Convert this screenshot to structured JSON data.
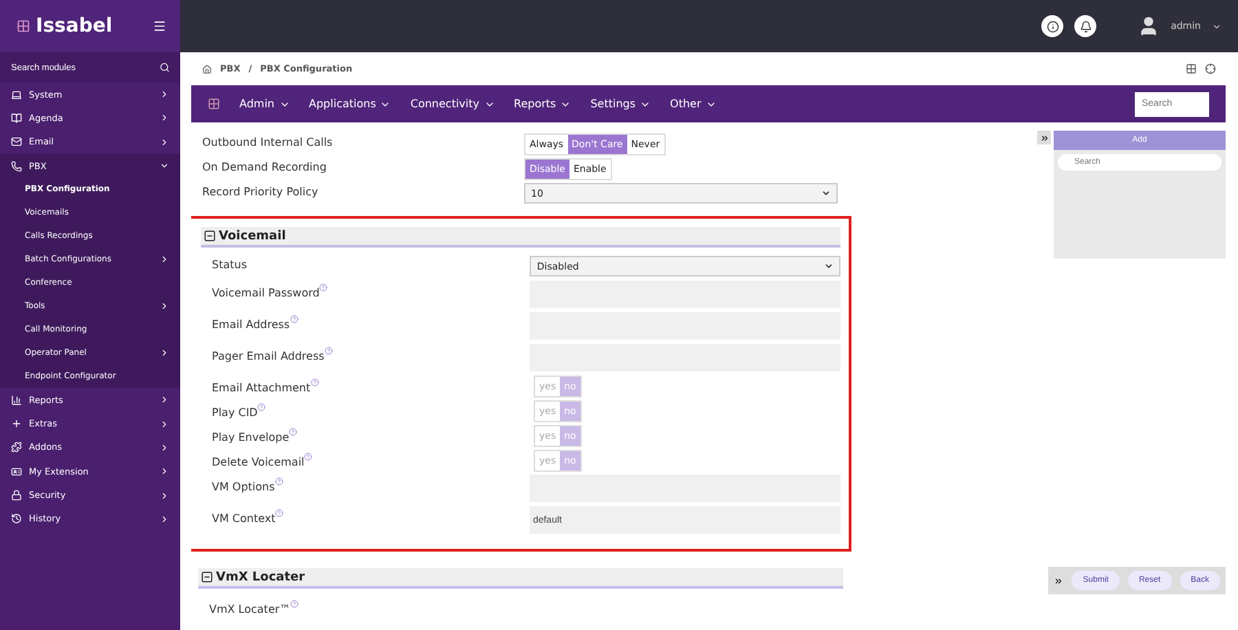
{
  "sidebar": {
    "logo": "Issabel",
    "search": {
      "placeholder": "Search modules"
    },
    "items": [
      {
        "label": "System",
        "selected": false,
        "expanded": false
      },
      {
        "label": "Agenda",
        "selected": false,
        "expanded": false
      },
      {
        "label": "Email",
        "selected": false,
        "expanded": false
      },
      {
        "label": "PBX",
        "selected": true,
        "expanded": true,
        "children": [
          {
            "label": "PBX Configuration",
            "kind": "link",
            "selected": true
          },
          {
            "label": "Voicemails",
            "kind": "link",
            "selected": false
          },
          {
            "label": "Calls Recordings",
            "kind": "link",
            "selected": false
          },
          {
            "label": "Batch Configurations",
            "kind": "group",
            "selected": false,
            "expanded": false
          },
          {
            "label": "Conference",
            "kind": "link",
            "selected": false
          },
          {
            "label": "Tools",
            "kind": "group",
            "selected": false,
            "expanded": false
          },
          {
            "label": "Call Monitoring",
            "kind": "link",
            "selected": false
          },
          {
            "label": "Operator Panel",
            "kind": "group",
            "selected": false,
            "expanded": false
          },
          {
            "label": "Endpoint Configurator",
            "kind": "link",
            "selected": false
          }
        ]
      },
      {
        "label": "Reports",
        "selected": false,
        "expanded": false
      },
      {
        "label": "Extras",
        "selected": false,
        "expanded": false
      },
      {
        "label": "Addons",
        "selected": false,
        "expanded": false
      },
      {
        "label": "My Extension",
        "selected": false,
        "expanded": false
      },
      {
        "label": "Security",
        "selected": false,
        "expanded": false
      },
      {
        "label": "History",
        "selected": false,
        "expanded": false
      }
    ]
  },
  "topbar": {
    "user": "admin"
  },
  "breadcrumb": {
    "items": [
      "PBX",
      "PBX Configuration"
    ],
    "separator": "/"
  },
  "menu": {
    "items": [
      "Admin",
      "Applications",
      "Connectivity",
      "Reports",
      "Settings",
      "Other"
    ],
    "search": {
      "placeholder": "Search"
    }
  },
  "form": {
    "rows": [
      {
        "label": "Outbound Internal Calls",
        "kind": "segmented",
        "options": [
          {
            "label": "Always",
            "selected": false
          },
          {
            "label": "Don't Care",
            "selected": true
          },
          {
            "label": "Never",
            "selected": false
          }
        ]
      },
      {
        "label": "On Demand Recording",
        "kind": "segmented",
        "options": [
          {
            "label": "Disable",
            "selected": true
          },
          {
            "label": "Enable",
            "selected": false
          }
        ]
      },
      {
        "label": "Record Priority Policy",
        "kind": "select",
        "value": "10"
      }
    ],
    "sections": [
      {
        "title": "Voicemail",
        "highlighted": true,
        "rows": [
          {
            "label": "Status",
            "kind": "select",
            "value": "Disabled"
          },
          {
            "label": "Voicemail Password",
            "help": true,
            "kind": "text",
            "value": ""
          },
          {
            "label": "Email Address",
            "help": true,
            "kind": "text",
            "value": ""
          },
          {
            "label": "Pager Email Address",
            "help": true,
            "kind": "text",
            "value": ""
          },
          {
            "label": "Email Attachment",
            "help": true,
            "kind": "segmented",
            "disabled": true,
            "options": [
              {
                "label": "yes",
                "selected": false
              },
              {
                "label": "no",
                "selected": true
              }
            ]
          },
          {
            "label": "Play CID",
            "help": true,
            "kind": "segmented",
            "disabled": true,
            "options": [
              {
                "label": "yes",
                "selected": false
              },
              {
                "label": "no",
                "selected": true
              }
            ]
          },
          {
            "label": "Play Envelope",
            "help": true,
            "kind": "segmented",
            "disabled": true,
            "options": [
              {
                "label": "yes",
                "selected": false
              },
              {
                "label": "no",
                "selected": true
              }
            ]
          },
          {
            "label": "Delete Voicemail",
            "help": true,
            "kind": "segmented",
            "disabled": true,
            "options": [
              {
                "label": "yes",
                "selected": false
              },
              {
                "label": "no",
                "selected": true
              }
            ]
          },
          {
            "label": "VM Options",
            "help": true,
            "kind": "text",
            "value": ""
          },
          {
            "label": "VM Context",
            "help": true,
            "kind": "text",
            "value": "default"
          }
        ]
      },
      {
        "title": "VmX Locater",
        "highlighted": false,
        "rows": [
          {
            "label": "VmX Locater™",
            "help": true,
            "kind": "none"
          }
        ]
      }
    ]
  },
  "side_panel": {
    "add": "Add",
    "search": {
      "placeholder": "Search"
    }
  },
  "actions": [
    "Submit",
    "Reset",
    "Back"
  ]
}
